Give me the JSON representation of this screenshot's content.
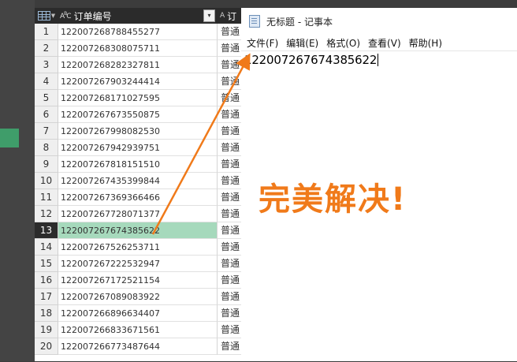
{
  "grid": {
    "column_header": "订单编号",
    "second_column_header": "订",
    "selected_row": 13,
    "rows": [
      {
        "n": "1",
        "id": "122007268788455277",
        "type": "普通"
      },
      {
        "n": "2",
        "id": "122007268308075711",
        "type": "普通"
      },
      {
        "n": "3",
        "id": "122007268282327811",
        "type": "普通"
      },
      {
        "n": "4",
        "id": "122007267903244414",
        "type": "普通"
      },
      {
        "n": "5",
        "id": "122007268171027595",
        "type": "普通"
      },
      {
        "n": "6",
        "id": "122007267673550875",
        "type": "普通"
      },
      {
        "n": "7",
        "id": "122007267998082530",
        "type": "普通"
      },
      {
        "n": "8",
        "id": "122007267942939751",
        "type": "普通"
      },
      {
        "n": "9",
        "id": "122007267818151510",
        "type": "普通"
      },
      {
        "n": "10",
        "id": "122007267435399844",
        "type": "普通"
      },
      {
        "n": "11",
        "id": "122007267369366466",
        "type": "普通"
      },
      {
        "n": "12",
        "id": "122007267728071377",
        "type": "普通"
      },
      {
        "n": "13",
        "id": "122007267674385622",
        "type": "普通"
      },
      {
        "n": "14",
        "id": "122007267526253711",
        "type": "普通"
      },
      {
        "n": "15",
        "id": "122007267222532947",
        "type": "普通"
      },
      {
        "n": "16",
        "id": "122007267172521154",
        "type": "普通"
      },
      {
        "n": "17",
        "id": "122007267089083922",
        "type": "普通"
      },
      {
        "n": "18",
        "id": "122007266896634407",
        "type": "普通"
      },
      {
        "n": "19",
        "id": "122007266833671561",
        "type": "普通"
      },
      {
        "n": "20",
        "id": "122007266773487644",
        "type": "普通"
      }
    ]
  },
  "notepad": {
    "title": "无标题 - 记事本",
    "menu": [
      "文件(F)",
      "编辑(E)",
      "格式(O)",
      "查看(V)",
      "帮助(H)"
    ],
    "content": "122007267674385622"
  },
  "annotation": {
    "text": "完美解决!",
    "color": "#f07a1a"
  }
}
